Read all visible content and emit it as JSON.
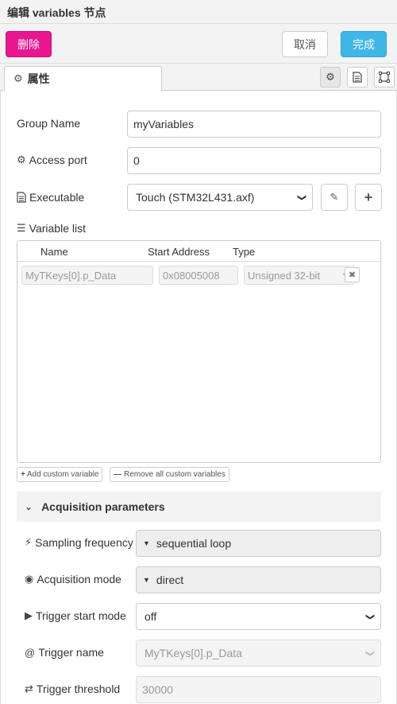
{
  "window": {
    "title": "编辑 variables 节点"
  },
  "toolbar": {
    "delete_label": "删除",
    "cancel_label": "取消",
    "done_label": "完成"
  },
  "tabs": {
    "properties_label": "属性"
  },
  "form": {
    "group_name": {
      "label": "Group Name",
      "value": "myVariables"
    },
    "access_port": {
      "label": "Access port",
      "value": "0"
    },
    "executable": {
      "label": "Executable",
      "value": "Touch (STM32L431.axf)"
    }
  },
  "variable_list": {
    "label": "Variable list",
    "columns": {
      "name": "Name",
      "start_address": "Start Address",
      "type": "Type"
    },
    "rows": [
      {
        "name": "MyTKeys[0].p_Data",
        "address": "0x08005008",
        "type": "Unsigned 32-bit"
      }
    ],
    "add_label": "Add custom variable",
    "remove_all_label": "Remove all custom variables"
  },
  "acquisition": {
    "section_title": "Acquisition parameters",
    "sampling_frequency": {
      "label": "Sampling frequency",
      "value": "sequential loop"
    },
    "acquisition_mode": {
      "label": "Acquisition mode",
      "value": "direct"
    },
    "trigger_start_mode": {
      "label": "Trigger start mode",
      "value": "off"
    },
    "trigger_name": {
      "label": "Trigger name",
      "value": "MyTKeys[0].p_Data"
    },
    "trigger_threshold": {
      "label": "Trigger threshold",
      "value": "30000"
    }
  },
  "colors": {
    "delete": "#e8168f",
    "done": "#3fb7e6"
  }
}
